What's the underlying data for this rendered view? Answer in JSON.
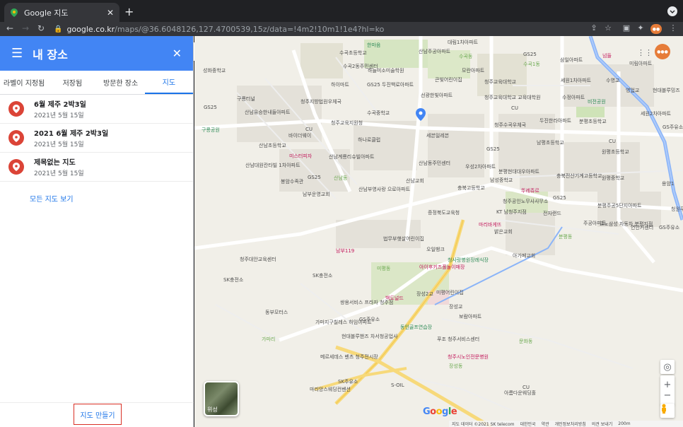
{
  "browser": {
    "tab_title": "Google 지도",
    "tab_close": "✕",
    "new_tab": "+",
    "url_host": "google.co.kr",
    "url_path": "/maps/@36.6048126,127.4700539,15z/data=!4m2!10m1!1e4?hl=ko",
    "profile_label": "●"
  },
  "sidebar": {
    "title": "내 장소",
    "tabs": [
      {
        "label": "라벨이 지정됨"
      },
      {
        "label": "저장됨"
      },
      {
        "label": "방문한 장소"
      },
      {
        "label": "지도"
      }
    ],
    "maps": [
      {
        "name": "6월 제주 2박3일",
        "date": "2021년 5월 15일"
      },
      {
        "name": "2021 6월 제주 2박3일",
        "date": "2021년 5월 15일"
      },
      {
        "name": "제목없는 지도",
        "date": "2021년 5월 15일"
      }
    ],
    "all_maps_link": "모든 지도 보기",
    "create_map_button": "지도 만들기"
  },
  "map": {
    "satellite_label": "위성",
    "google_logo": "Google",
    "footer": [
      "지도 데이터 ©2021 SK telecom",
      "대한민국",
      "약관",
      "개인정보처리방침",
      "의견 보내기",
      "200m"
    ],
    "labels": [
      {
        "t": "성화중학교",
        "c": ""
      },
      {
        "t": "한마음",
        "c": "green"
      },
      {
        "t": "수곡초등학교",
        "c": ""
      },
      {
        "t": "산남주공아파트",
        "c": ""
      },
      {
        "t": "대림1차아파트",
        "c": ""
      },
      {
        "t": "수곡동",
        "c": "lgreen"
      },
      {
        "t": "GS25",
        "c": ""
      },
      {
        "t": "삼일아파트",
        "c": ""
      },
      {
        "t": "넘들",
        "c": "pink"
      },
      {
        "t": "미림아파트",
        "c": ""
      },
      {
        "t": "수곡2동주민센터",
        "c": ""
      },
      {
        "t": "하늘미소미술학원",
        "c": ""
      },
      {
        "t": "모란아파트",
        "c": ""
      },
      {
        "t": "수곡1동",
        "c": "lgreen"
      },
      {
        "t": "하이마트",
        "c": ""
      },
      {
        "t": "GS25 두진백로아파트",
        "c": ""
      },
      {
        "t": "큰빛어린이집",
        "c": ""
      },
      {
        "t": "청주교육대학교",
        "c": ""
      },
      {
        "t": "세원1차아파트",
        "c": ""
      },
      {
        "t": "수영교",
        "c": ""
      },
      {
        "t": "영업교",
        "c": ""
      },
      {
        "t": "현대블루밍즈",
        "c": ""
      },
      {
        "t": "구룡터널",
        "c": ""
      },
      {
        "t": "청주지방법원우체국",
        "c": ""
      },
      {
        "t": "선광한빛아파트",
        "c": ""
      },
      {
        "t": "청주교육대학교 교육대학원",
        "c": ""
      },
      {
        "t": "수정아파트",
        "c": ""
      },
      {
        "t": "비전공원",
        "c": "green"
      },
      {
        "t": "GS25",
        "c": ""
      },
      {
        "t": "산남유승한내들아파트",
        "c": ""
      },
      {
        "t": "수곡중학교",
        "c": ""
      },
      {
        "t": "CU",
        "c": ""
      },
      {
        "t": "두진한라아파트",
        "c": ""
      },
      {
        "t": "분평초등학교",
        "c": ""
      },
      {
        "t": "세원2차아파트",
        "c": ""
      },
      {
        "t": "청주교육지원청",
        "c": ""
      },
      {
        "t": "세븐일레븐",
        "c": ""
      },
      {
        "t": "GS주유소",
        "c": ""
      },
      {
        "t": "구룡공원",
        "c": "green"
      },
      {
        "t": "CU",
        "c": ""
      },
      {
        "t": "바이더웨이",
        "c": ""
      },
      {
        "t": "하나로클럽",
        "c": ""
      },
      {
        "t": "청주수곡우체국",
        "c": ""
      },
      {
        "t": "남평초등학교",
        "c": ""
      },
      {
        "t": "CU",
        "c": ""
      },
      {
        "t": "산남초등학교",
        "c": ""
      },
      {
        "t": "GS25",
        "c": ""
      },
      {
        "t": "원평초등학교",
        "c": ""
      },
      {
        "t": "미스터피자",
        "c": "pink"
      },
      {
        "t": "산남계룡리슈빌아파트",
        "c": ""
      },
      {
        "t": "산남대원칸타빌 1차아파트",
        "c": ""
      },
      {
        "t": "산남동주민센터",
        "c": ""
      },
      {
        "t": "우성2차아파트",
        "c": ""
      },
      {
        "t": "분평현대대우아파트",
        "c": ""
      },
      {
        "t": "충북전산기계고등학교",
        "c": ""
      },
      {
        "t": "용암1",
        "c": ""
      },
      {
        "t": "봉암수족관",
        "c": ""
      },
      {
        "t": "GS25",
        "c": ""
      },
      {
        "t": "산남동",
        "c": "lgreen"
      },
      {
        "t": "산남교회",
        "c": ""
      },
      {
        "t": "남성중학교",
        "c": ""
      },
      {
        "t": "충북고등학교",
        "c": ""
      },
      {
        "t": "뚜레쥬르",
        "c": "pink"
      },
      {
        "t": "원평중학교",
        "c": ""
      },
      {
        "t": "남부운영교회",
        "c": ""
      },
      {
        "t": "산남부영사랑 으로아파트",
        "c": ""
      },
      {
        "t": "청주공인노무사사무소",
        "c": ""
      },
      {
        "t": "GS25",
        "c": ""
      },
      {
        "t": "분평주공5단지아파트",
        "c": ""
      },
      {
        "t": "청원푸르지오",
        "c": ""
      },
      {
        "t": "증정북도교육청",
        "c": ""
      },
      {
        "t": "KT 남청주지점",
        "c": ""
      },
      {
        "t": "전자랜드",
        "c": ""
      },
      {
        "t": "분평동",
        "c": "lgreen"
      },
      {
        "t": "법무부햇살어린이집",
        "c": ""
      },
      {
        "t": "마리바게뜨",
        "c": "pink"
      },
      {
        "t": "밝은교회",
        "c": ""
      },
      {
        "t": "주공아파트",
        "c": ""
      },
      {
        "t": "르노삼성 자동차 분평지점",
        "c": ""
      },
      {
        "t": "연안커센터",
        "c": ""
      },
      {
        "t": "GS주유소",
        "c": ""
      },
      {
        "t": "남부119",
        "c": "pink"
      },
      {
        "t": "오일뱅크",
        "c": ""
      },
      {
        "t": "아가페교회",
        "c": ""
      },
      {
        "t": "청주대안교육센터",
        "c": ""
      },
      {
        "t": "청사랑병원장례식장",
        "c": "green"
      },
      {
        "t": "미평동",
        "c": "lgreen"
      },
      {
        "t": "아이후키즈풀놀이매장",
        "c": "pink"
      },
      {
        "t": "SK충전소",
        "c": ""
      },
      {
        "t": "SK충전소",
        "c": ""
      },
      {
        "t": "장성2교",
        "c": ""
      },
      {
        "t": "미평어린이집",
        "c": ""
      },
      {
        "t": "쌍용서비스 프라자 청주점",
        "c": ""
      },
      {
        "t": "백도널드",
        "c": "pink"
      },
      {
        "t": "장성교",
        "c": ""
      },
      {
        "t": "동부모터스",
        "c": ""
      },
      {
        "t": "가마지구칠레스 하임아파트",
        "c": ""
      },
      {
        "t": "GS주유소",
        "c": ""
      },
      {
        "t": "보람아파트",
        "c": ""
      },
      {
        "t": "동인골프연습장",
        "c": "green"
      },
      {
        "t": "가마리",
        "c": "lgreen"
      },
      {
        "t": "현대블루핸즈 차서청공업사",
        "c": ""
      },
      {
        "t": "푸조 청주서비스센터",
        "c": ""
      },
      {
        "t": "문화동",
        "c": "lgreen"
      },
      {
        "t": "메르세데스 벤츠 청주전시장",
        "c": ""
      },
      {
        "t": "청주시노인전문병원",
        "c": "pink"
      },
      {
        "t": "장성동",
        "c": "lgreen"
      },
      {
        "t": "SK주유소",
        "c": ""
      },
      {
        "t": "마리앙스웨딩컨벤션",
        "c": ""
      },
      {
        "t": "S-OIL",
        "c": ""
      },
      {
        "t": "CU",
        "c": ""
      },
      {
        "t": "아름다운웨딩홀",
        "c": ""
      }
    ]
  }
}
